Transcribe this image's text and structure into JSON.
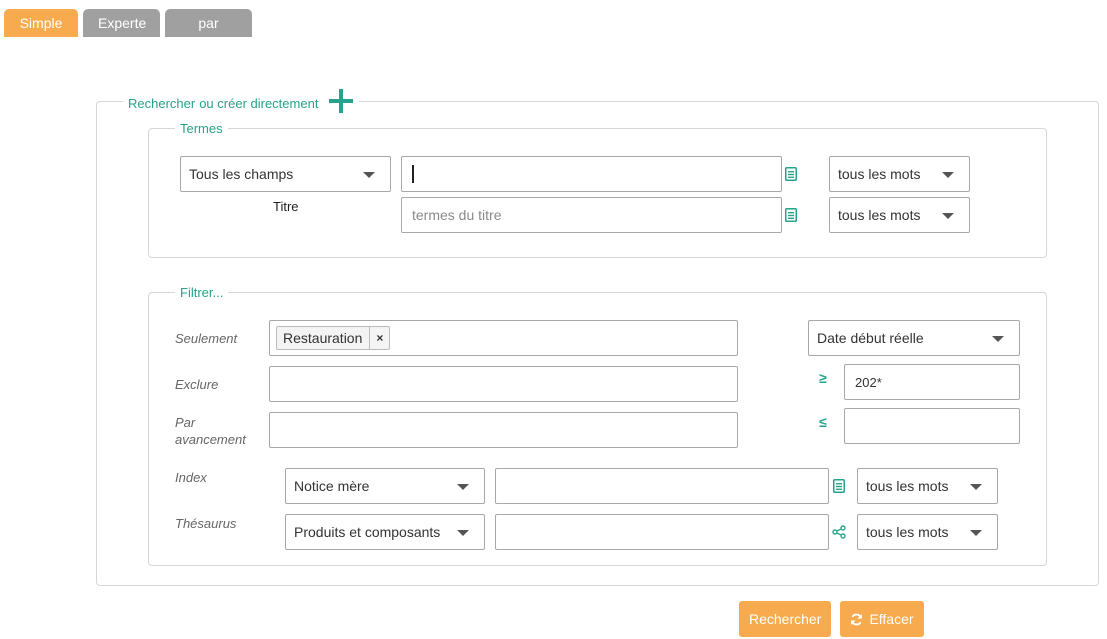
{
  "tabs": [
    {
      "label": "Simple",
      "active": true
    },
    {
      "label": "Experte",
      "active": false
    },
    {
      "label": "par Liens",
      "active": false
    }
  ],
  "main_legend": {
    "part1": "Rechercher",
    "part2": "ou créer directement"
  },
  "termes": {
    "legend": "Termes",
    "field_select": "Tous les champs",
    "title_label": "Titre",
    "input1_value": "",
    "input2_placeholder": "termes du titre",
    "mode1": "tous les mots",
    "mode2": "tous les mots"
  },
  "filtrer": {
    "legend": "Filtrer...",
    "seulement_label": "Seulement",
    "seulement_chip": "Restauration",
    "chip_remove": "×",
    "exclure_label": "Exclure",
    "avancement_label": "Par\navancement",
    "date_select": "Date début réelle",
    "ge_symbol": "≥",
    "le_symbol": "≤",
    "date_from": "202*",
    "date_to": "",
    "index_label": "Index",
    "index_select": "Notice mère",
    "index_mode": "tous les mots",
    "thesaurus_label": "Thésaurus",
    "thesaurus_select": "Produits et composants",
    "thesaurus_mode": "tous les mots"
  },
  "buttons": {
    "search": "Rechercher",
    "clear": "Effacer"
  },
  "colors": {
    "accent_orange": "#f7ab4e",
    "accent_green": "#26a38a",
    "tab_inactive": "#a0a0a0"
  },
  "icons": {
    "add": "plus-icon",
    "list": "list-icon",
    "share": "share-icon",
    "refresh": "refresh-icon"
  }
}
